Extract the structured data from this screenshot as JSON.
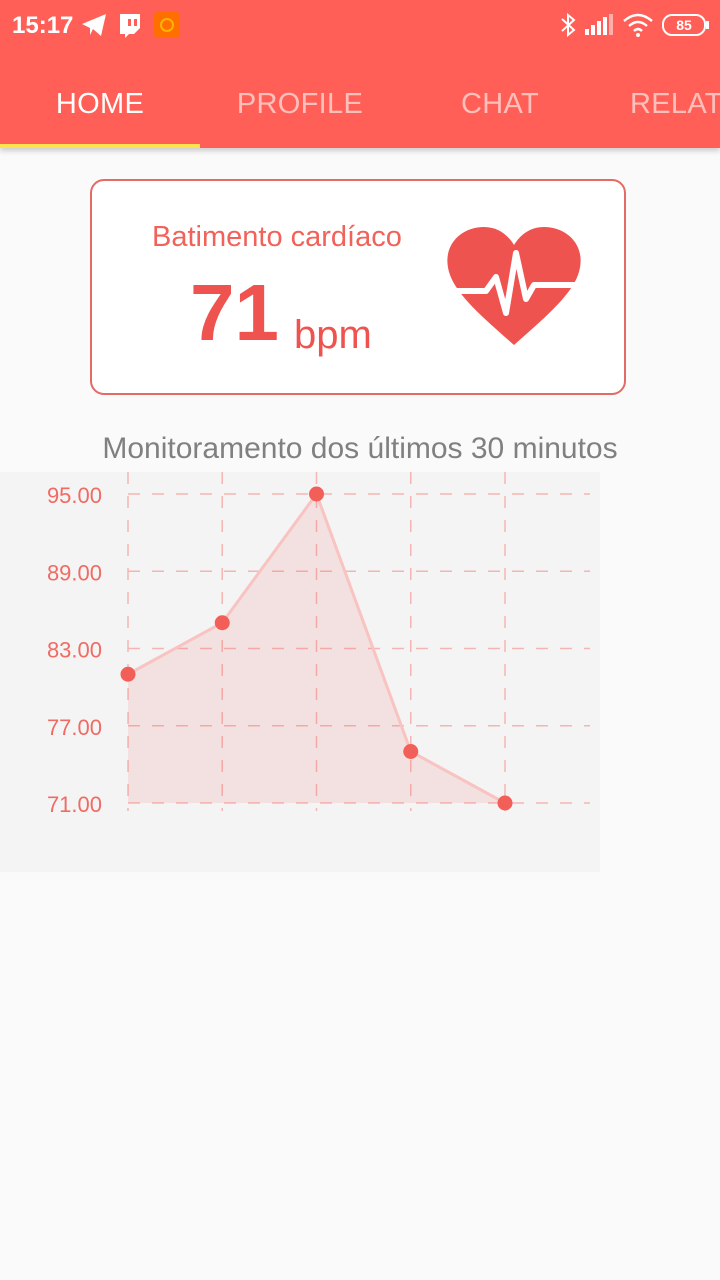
{
  "status_bar": {
    "time": "15:17",
    "battery": "85",
    "icons": [
      "telegram-icon",
      "twitch-icon",
      "app-notification-icon",
      "bluetooth-icon",
      "signal-icon",
      "wifi-icon",
      "battery-icon"
    ]
  },
  "tabs": [
    {
      "label": "HOME",
      "active": true
    },
    {
      "label": "PROFILE",
      "active": false
    },
    {
      "label": "CHAT",
      "active": false
    },
    {
      "label": "RELAT",
      "active": false
    }
  ],
  "colors": {
    "primary": "#ff5f56",
    "indicator": "#ffe34d",
    "accent": "#ef5350"
  },
  "heart_card": {
    "label": "Batimento cardíaco",
    "value": "71",
    "unit": "bpm",
    "icon": "heart-rate-icon"
  },
  "chart_title": "Monitoramento dos últimos 30 minutos",
  "chart_data": {
    "type": "area",
    "title": "Monitoramento dos últimos 30 minutos",
    "xlabel": "",
    "ylabel": "",
    "x": [
      1,
      2,
      3,
      4,
      5
    ],
    "series": [
      {
        "values": [
          81,
          85,
          95,
          75,
          71
        ]
      }
    ],
    "yticks": [
      "95.00",
      "89.00",
      "83.00",
      "77.00",
      "71.00"
    ],
    "ylim": [
      71,
      95
    ],
    "grid": true,
    "grid_style": "dashed"
  }
}
